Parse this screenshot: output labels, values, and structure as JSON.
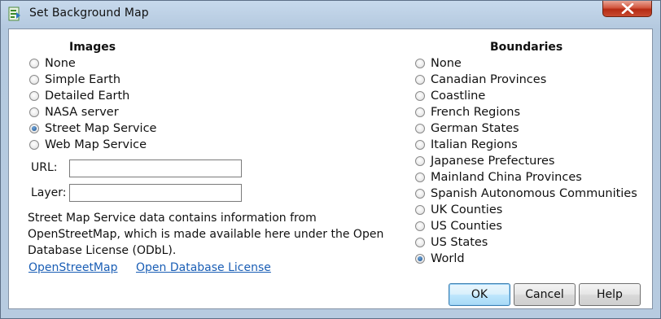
{
  "window": {
    "title": "Set Background Map"
  },
  "images": {
    "heading": "Images",
    "options": [
      "None",
      "Simple Earth",
      "Detailed Earth",
      "NASA server",
      "Street Map Service",
      "Web Map Service"
    ],
    "selected": "Street Map Service",
    "url_label": "URL:",
    "url_value": "",
    "layer_label": "Layer:",
    "layer_value": ""
  },
  "notice": "Street Map Service data contains information from OpenStreetMap, which is made available here under the Open Database License (ODbL).",
  "links": {
    "osm": "OpenStreetMap",
    "odbl": "Open Database License"
  },
  "boundaries": {
    "heading": "Boundaries",
    "options": [
      "None",
      "Canadian Provinces",
      "Coastline",
      "French Regions",
      "German States",
      "Italian Regions",
      "Japanese Prefectures",
      "Mainland China Provinces",
      "Spanish Autonomous Communities",
      "UK Counties",
      "US Counties",
      "US States",
      "World"
    ],
    "selected": "World"
  },
  "buttons": {
    "ok": "OK",
    "cancel": "Cancel",
    "help": "Help"
  },
  "colors": {
    "accent": "#1c4f8a",
    "link": "#1a5eb5",
    "close": "#c84a30"
  }
}
